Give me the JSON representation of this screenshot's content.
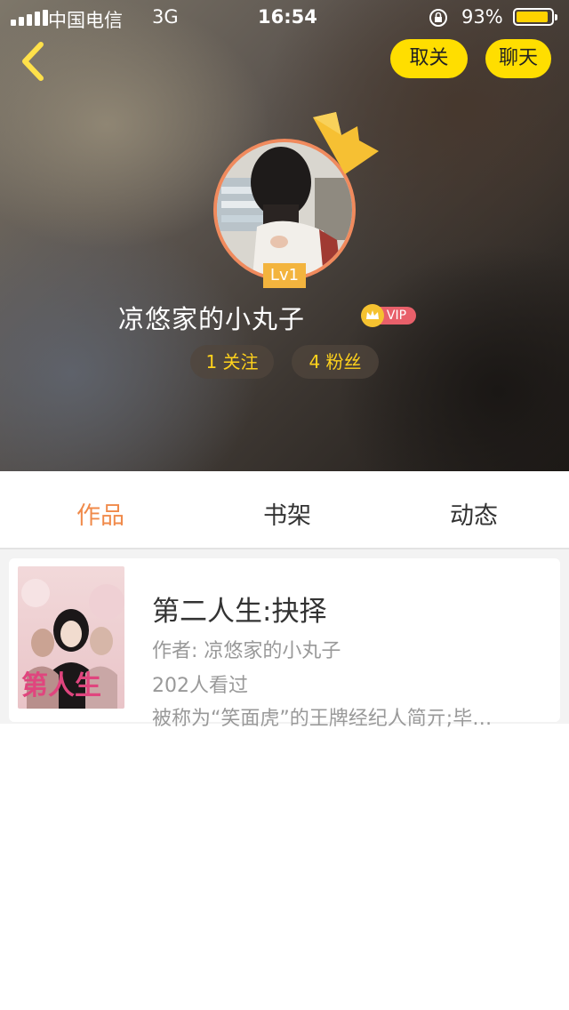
{
  "status_bar": {
    "carrier": "中国电信",
    "network": "3G",
    "time": "16:54",
    "battery_percent": "93%",
    "battery_level": 0.93,
    "battery_color": "#ffd200"
  },
  "header": {
    "back_icon": "chevron-left-icon",
    "unfollow_label": "取关",
    "chat_label": "聊天",
    "accent_color": "#ffde00"
  },
  "profile": {
    "level": "Lv1",
    "username": "凉悠家的小丸子",
    "vip_label": "VIP",
    "following": "1 关注",
    "fans": "4 粉丝",
    "stat_color": "#ffd21c",
    "avatar_border_color": "#f08a5d"
  },
  "tabs": [
    {
      "label": "作品",
      "active": true
    },
    {
      "label": "书架",
      "active": false
    },
    {
      "label": "动态",
      "active": false
    }
  ],
  "active_tab_color": "#f08a4a",
  "books": [
    {
      "title": "第二人生:抉择",
      "author": "作者: 凉悠家的小丸子",
      "views": "202人看过",
      "description": "被称为“笑面虎”的王牌经纪人简亓;毕…",
      "cover_text": "第人生"
    }
  ]
}
